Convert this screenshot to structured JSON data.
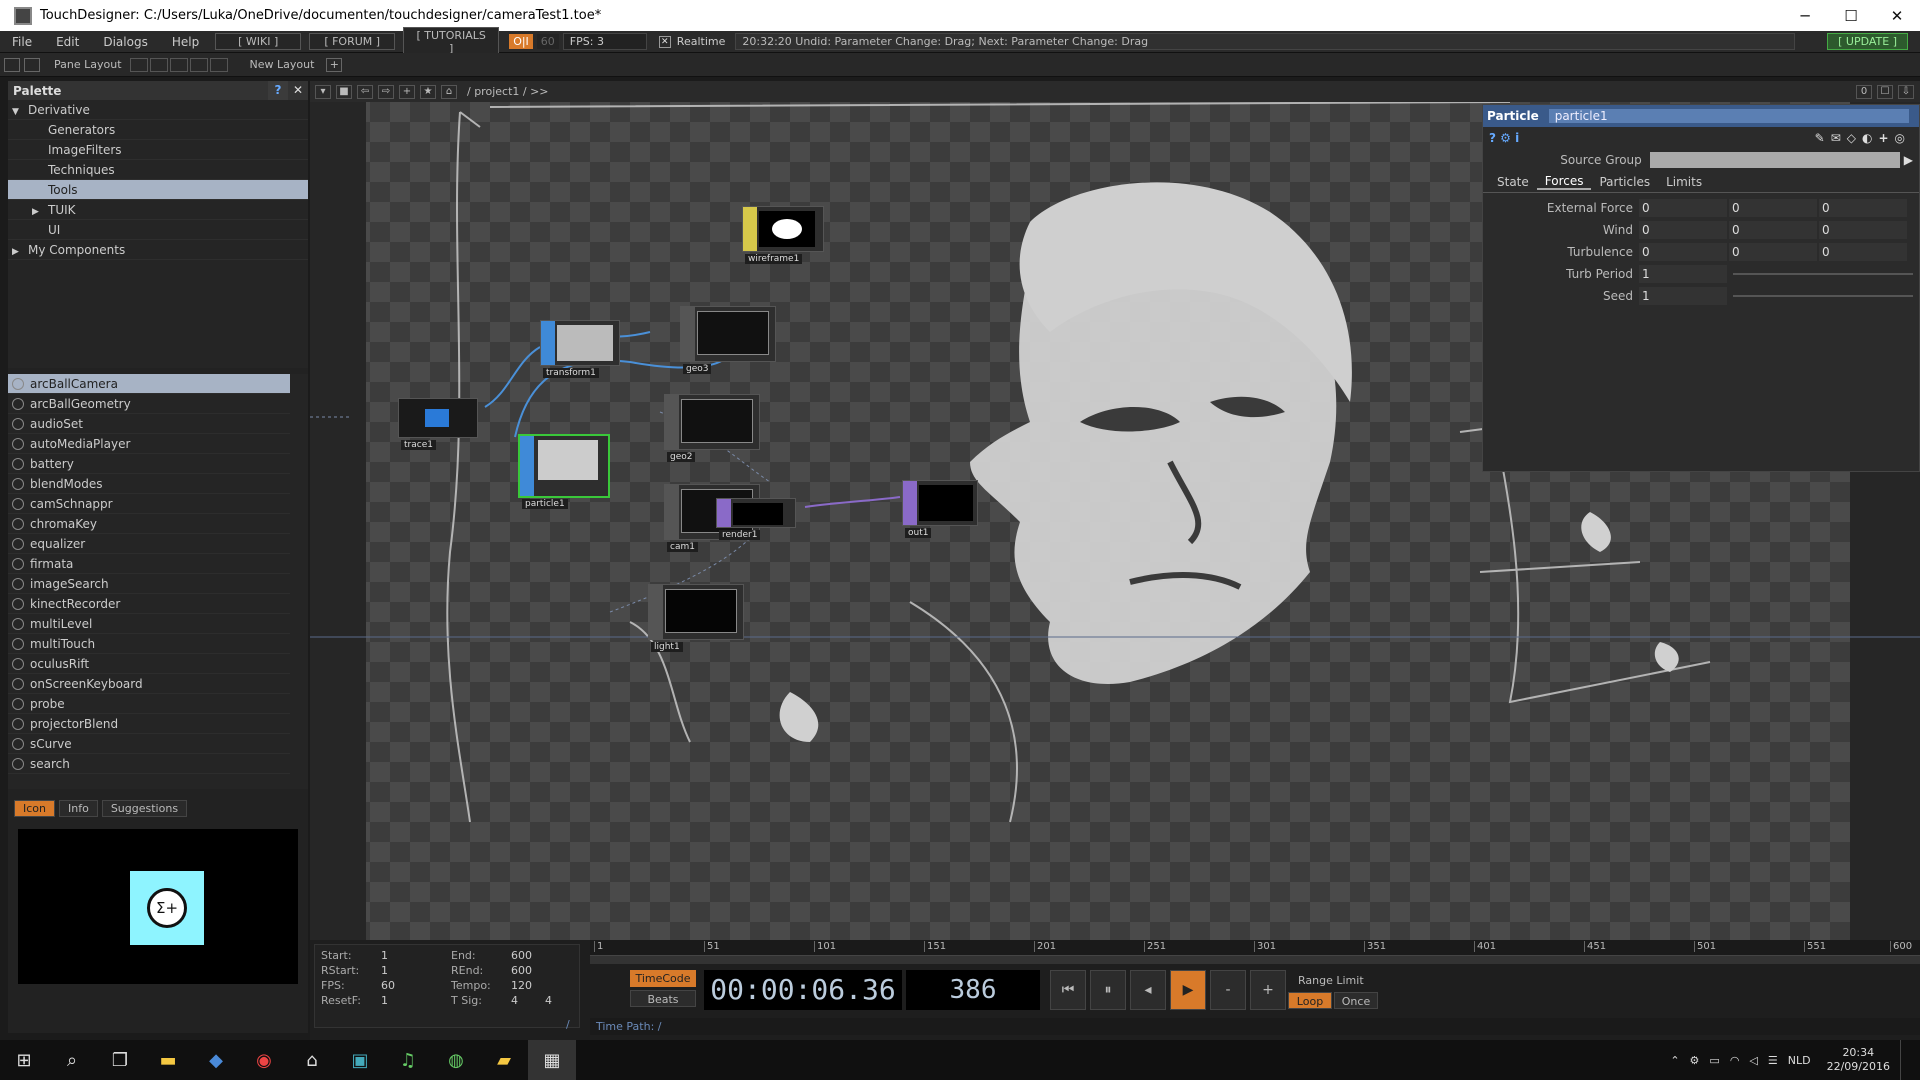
{
  "window": {
    "title": "TouchDesigner: C:/Users/Luka/OneDrive/documenten/touchdesigner/cameraTest1.toe*"
  },
  "menu": {
    "items": [
      "File",
      "Edit",
      "Dialogs",
      "Help"
    ],
    "wiki": "[ WIKI ]",
    "forum": "[ FORUM ]",
    "tutorials": "[ TUTORIALS ]",
    "oi": "O|I",
    "sixty": "60",
    "fps": "FPS:  3",
    "realtime": "Realtime",
    "status": "20:32:20 Undid: Parameter Change: Drag; Next: Parameter Change: Drag",
    "update": "[ UPDATE ]"
  },
  "toolbar": {
    "pane_layout": "Pane Layout",
    "new_layout": "New Layout"
  },
  "palette": {
    "title": "Palette",
    "help": "?",
    "close": "✕",
    "tree": [
      {
        "label": "Derivative",
        "indent": 0,
        "arrow": "▼",
        "selected": false
      },
      {
        "label": "Generators",
        "indent": 1,
        "arrow": "",
        "selected": false
      },
      {
        "label": "ImageFilters",
        "indent": 1,
        "arrow": "",
        "selected": false
      },
      {
        "label": "Techniques",
        "indent": 1,
        "arrow": "",
        "selected": false
      },
      {
        "label": "Tools",
        "indent": 1,
        "arrow": "",
        "selected": true
      },
      {
        "label": "TUIK",
        "indent": 1,
        "arrow": "▶",
        "selected": false
      },
      {
        "label": "UI",
        "indent": 1,
        "arrow": "",
        "selected": false
      },
      {
        "label": "My Components",
        "indent": 0,
        "arrow": "▶",
        "selected": false
      }
    ],
    "items": [
      "arcBallCamera",
      "arcBallGeometry",
      "audioSet",
      "autoMediaPlayer",
      "battery",
      "blendModes",
      "camSchnappr",
      "chromaKey",
      "equalizer",
      "firmata",
      "imageSearch",
      "kinectRecorder",
      "multiLevel",
      "multiTouch",
      "oculusRift",
      "onScreenKeyboard",
      "probe",
      "projectorBlend",
      "sCurve",
      "search"
    ],
    "selected_item": "arcBallCamera",
    "tabs": [
      "Icon",
      "Info",
      "Suggestions"
    ],
    "active_tab": "Icon",
    "preview_glyph": "Σ+"
  },
  "network": {
    "path": "/ project1 / >>",
    "nodes": [
      {
        "label": "wireframe1",
        "color": "#d6c84a"
      },
      {
        "label": "transform1",
        "color": "#3f8ad8"
      },
      {
        "label": "geo3",
        "color": "#666666"
      },
      {
        "label": "trace1",
        "color": "#2a7ad8"
      },
      {
        "label": "geo2",
        "color": "#666666"
      },
      {
        "label": "particle1",
        "color": "#3f8ad8"
      },
      {
        "label": "cam1",
        "color": "#666666"
      },
      {
        "label": "render1",
        "color": "#8a6ac8"
      },
      {
        "label": "out1",
        "color": "#8a6ac8"
      },
      {
        "label": "light1",
        "color": "#666666"
      }
    ]
  },
  "params": {
    "type": "Particle",
    "name": "particle1",
    "help_icons": "?  ⚙  i",
    "tool_icons": "✎✉◇◐+◎",
    "source_group_label": "Source Group",
    "tabs": [
      "State",
      "Forces",
      "Particles",
      "Limits"
    ],
    "active_tab": "Forces",
    "rows": [
      {
        "label": "External Force",
        "values": [
          "0",
          "0",
          "0"
        ]
      },
      {
        "label": "Wind",
        "values": [
          "0",
          "0",
          "0"
        ]
      },
      {
        "label": "Turbulence",
        "values": [
          "0",
          "0",
          "0"
        ]
      },
      {
        "label": "Turb Period",
        "values": [
          "1"
        ]
      },
      {
        "label": "Seed",
        "values": [
          "1"
        ]
      }
    ]
  },
  "timeline": {
    "ticks": [
      "1",
      "51",
      "101",
      "151",
      "201",
      "251",
      "301",
      "351",
      "401",
      "451",
      "501",
      "551",
      "600"
    ],
    "info": {
      "start_k": "Start:",
      "start": "1",
      "end_k": "End:",
      "end": "600",
      "rstart_k": "RStart:",
      "rstart": "1",
      "rend_k": "REnd:",
      "rend": "600",
      "fps_k": "FPS:",
      "fps": "60",
      "tempo_k": "Tempo:",
      "tempo": "120",
      "resetf_k": "ResetF:",
      "resetf": "1",
      "tsig_k": "T Sig:",
      "tsig1": "4",
      "tsig2": "4"
    },
    "timecode_btn": "TimeCode",
    "beats_btn": "Beats",
    "time": "00:00:06.36",
    "frame": "386",
    "range_limit": "Range Limit",
    "loop": "Loop",
    "once": "Once",
    "time_path": "Time Path: /",
    "slash": "/"
  },
  "taskbar": {
    "lang": "NLD",
    "time": "20:34",
    "date": "22/09/2016"
  }
}
